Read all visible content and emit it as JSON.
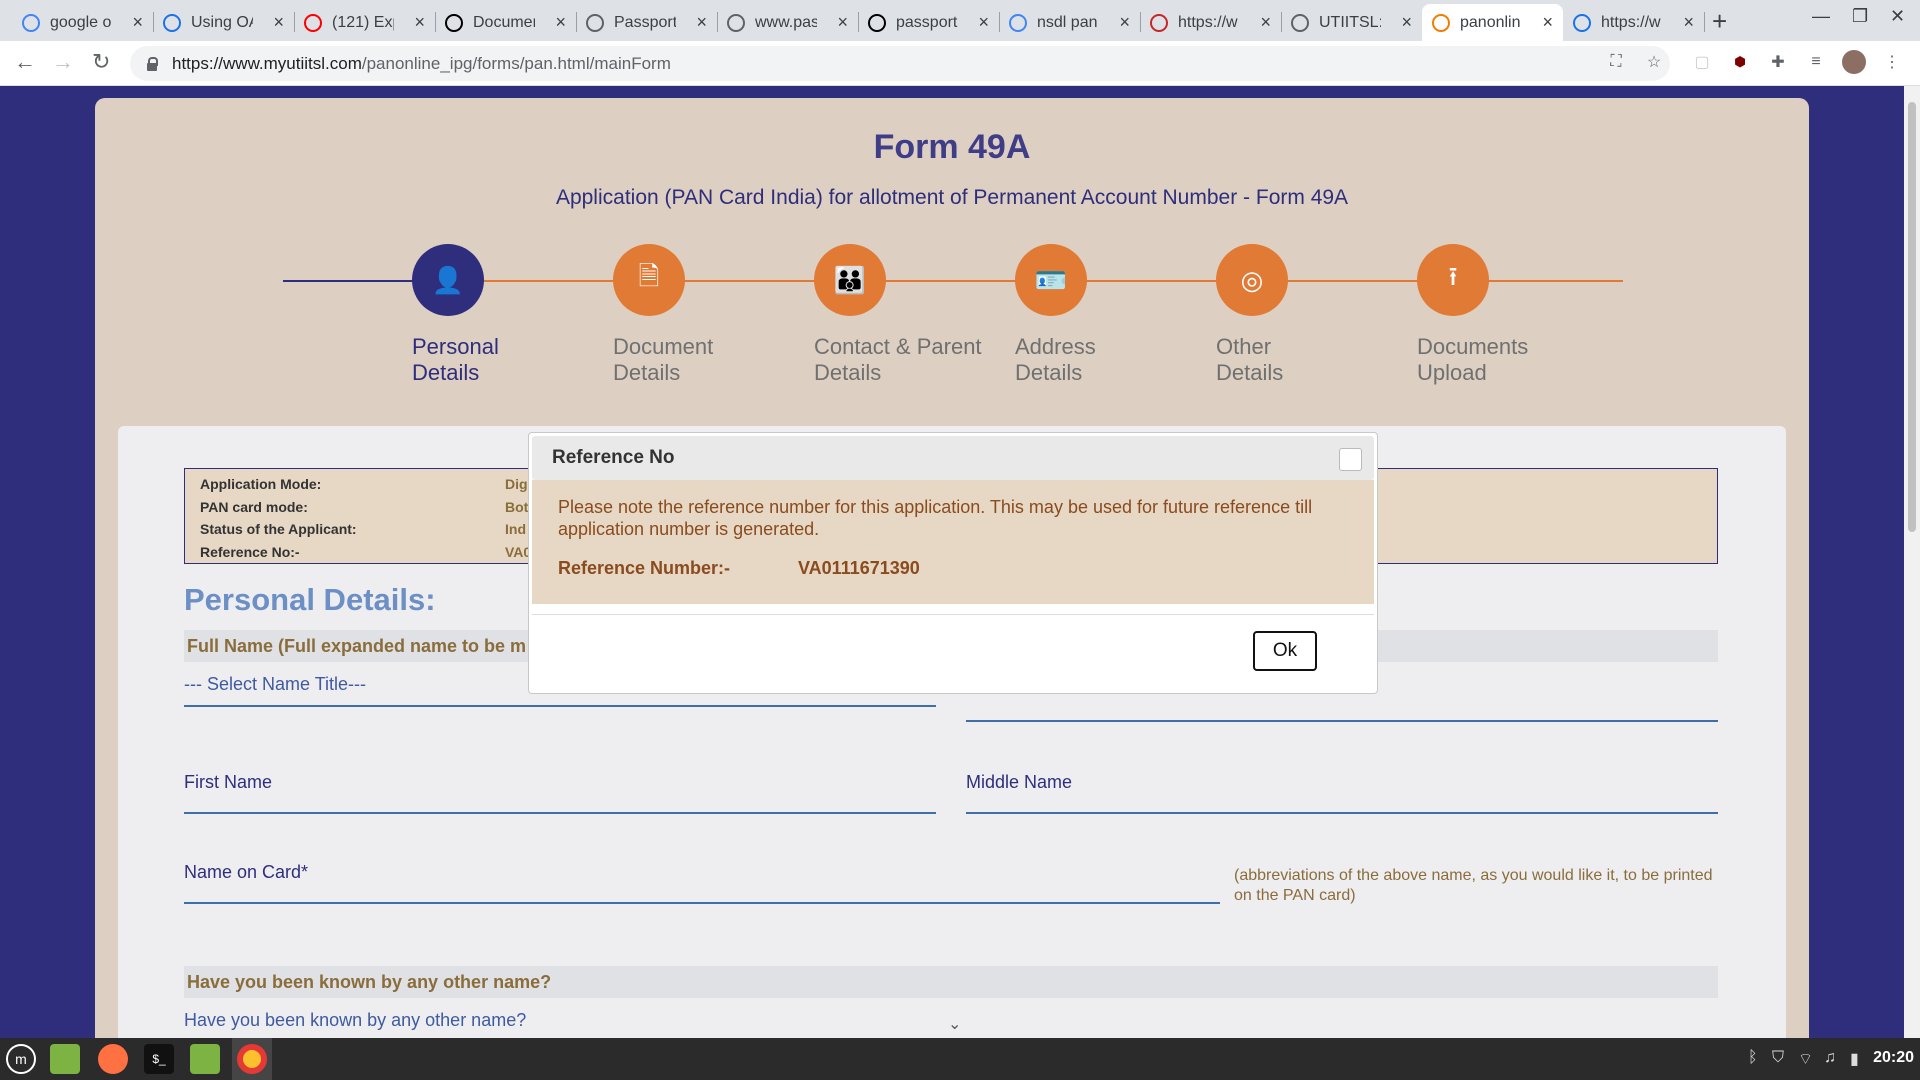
{
  "browser": {
    "tabs": [
      {
        "title": "google o",
        "favicon": "google-icon",
        "color": "#4285f4"
      },
      {
        "title": "Using OA",
        "favicon": "code-icon",
        "color": "#1a73e8"
      },
      {
        "title": "(121) Exp",
        "favicon": "youtube-icon",
        "color": "#ff0000"
      },
      {
        "title": "Documen",
        "favicon": "p-logo-icon",
        "color": "#000000"
      },
      {
        "title": "Passport",
        "favicon": "globe-icon",
        "color": "#5f6368"
      },
      {
        "title": "www.pas",
        "favicon": "globe-icon",
        "color": "#5f6368"
      },
      {
        "title": "passport",
        "favicon": "p-logo-icon",
        "color": "#000000"
      },
      {
        "title": "nsdl pan",
        "favicon": "google-icon",
        "color": "#4285f4"
      },
      {
        "title": "https://w",
        "favicon": "nsdl-icon",
        "color": "#c62828"
      },
      {
        "title": "UTIITSL:",
        "favicon": "globe-icon",
        "color": "#5f6368"
      },
      {
        "title": "panonlin",
        "favicon": "utiitsl-icon",
        "color": "#f57c00",
        "active": true
      },
      {
        "title": "https://w",
        "favicon": "edge-icon",
        "color": "#1a73e8"
      }
    ],
    "url_host": "https://www.myutiitsl.com",
    "url_path": "/panonline_ipg/forms/pan.html/mainForm"
  },
  "page": {
    "title": "Form 49A",
    "subtitle": "Application (PAN Card India) for allotment of Permanent Account Number - Form 49A",
    "steps": [
      {
        "line1": "Personal",
        "line2": "Details",
        "icon": "person-icon",
        "glyph": "👤",
        "active": true
      },
      {
        "line1": "Document",
        "line2": "Details",
        "icon": "document-icon",
        "glyph": "🗎"
      },
      {
        "line1": "Contact & Parent",
        "line2": "Details",
        "icon": "family-icon",
        "glyph": "👪"
      },
      {
        "line1": "Address",
        "line2": "Details",
        "icon": "address-card-icon",
        "glyph": "🪪"
      },
      {
        "line1": "Other",
        "line2": "Details",
        "icon": "target-icon",
        "glyph": "◎"
      },
      {
        "line1": "Documents",
        "line2": "Upload",
        "icon": "upload-icon",
        "glyph": "⭱"
      }
    ],
    "info": [
      {
        "label": "Application Mode:",
        "value": "Dig"
      },
      {
        "label": "PAN card mode:",
        "value": "Bot"
      },
      {
        "label": "Status of the Applicant:",
        "value": "Ind"
      },
      {
        "label": "Reference No:-",
        "value": "VA0"
      }
    ],
    "section_title": "Personal Details:",
    "full_name_bar": "Full Name (Full expanded name to be m",
    "name_title_select": "--- Select Name Title---",
    "first_name_label": "First Name",
    "middle_name_label": "Middle Name",
    "name_on_card_label": "Name on Card*",
    "name_on_card_hint": "(abbreviations of the above name, as you would like it, to be printed on the PAN card)",
    "other_name_bar": "Have you been known by any other name?",
    "other_name_select": "Have you been known by any other name?"
  },
  "modal": {
    "title": "Reference No",
    "message": "Please note the reference number for this application. This may be used for future reference till application number is generated.",
    "ref_label": "Reference Number:-",
    "ref_value": "VA0111671390",
    "ok_label": "Ok"
  },
  "taskbar": {
    "clock": "20:20"
  }
}
